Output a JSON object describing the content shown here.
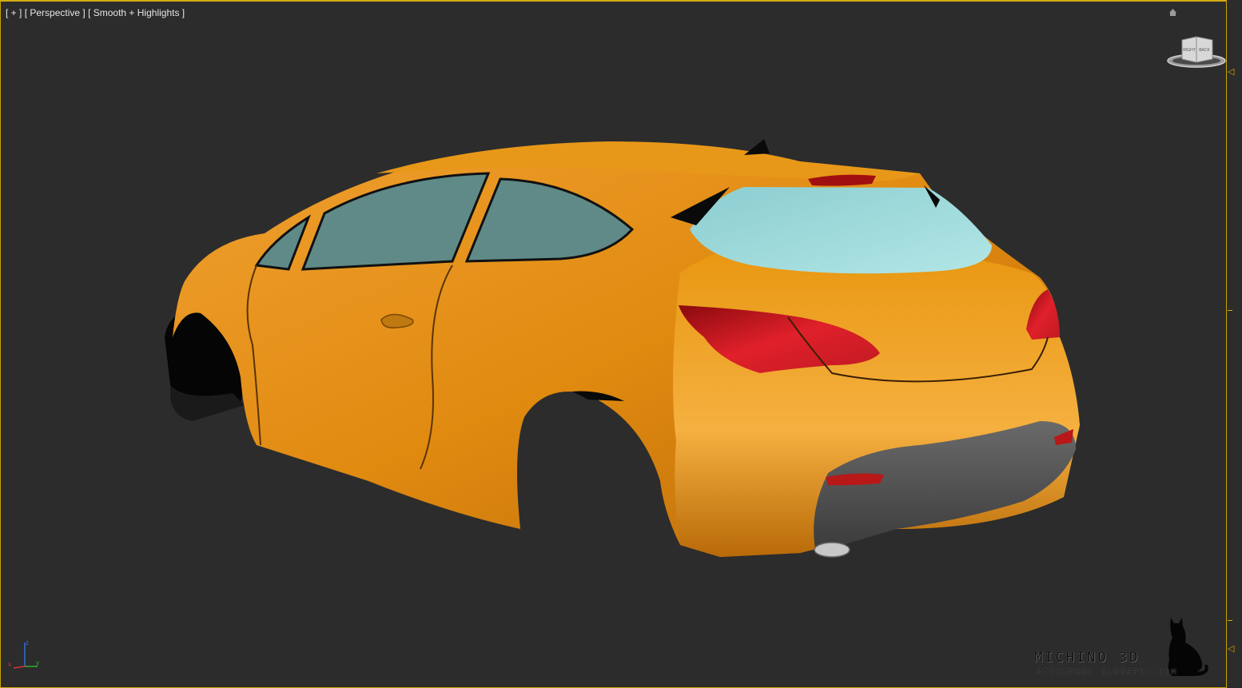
{
  "viewport": {
    "label_plus": "[ + ]",
    "label_view": "[ Perspective ]",
    "label_shading": "[ Smooth + Highlights ]"
  },
  "viewcube": {
    "face_left": "RIGHT",
    "face_right": "BACK"
  },
  "axis": {
    "x": "x",
    "y": "y",
    "z": "z"
  },
  "watermark": {
    "title": "MICHINO 3D",
    "url": "MICHINO3D.BLOGSPOT.COM"
  },
  "colors": {
    "body": "#e08a10",
    "glass_side": "#5f8a88",
    "glass_rear": "#a7e0e0",
    "taillight": "#c0121a",
    "bumper_trim": "#5a5a5a",
    "viewport_border": "#c8a400",
    "background": "#2c2c2c"
  },
  "icons": {
    "home": "home-icon",
    "viewcube": "viewcube-icon",
    "axis": "axis-tripod-icon",
    "cat": "cat-silhouette-icon"
  }
}
